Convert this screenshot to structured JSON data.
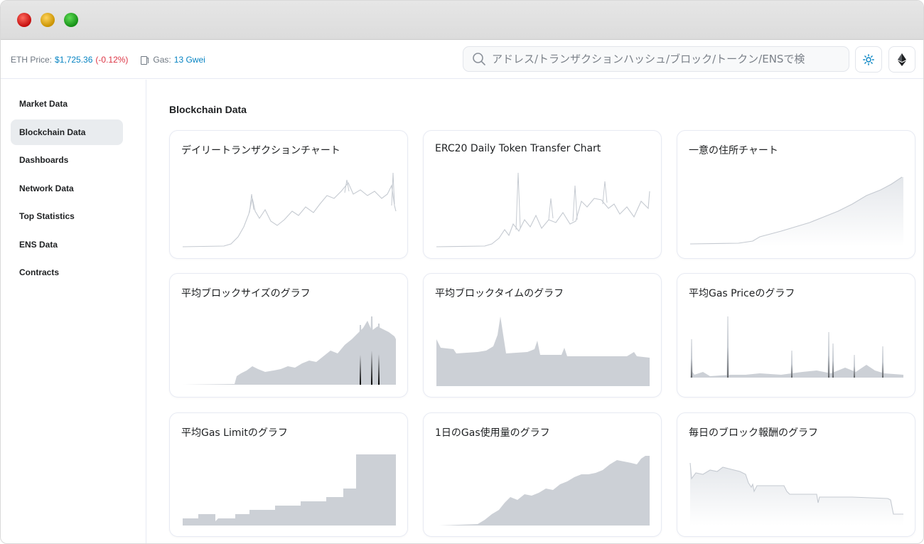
{
  "topbar": {
    "eth_price_label": "ETH Price:",
    "eth_price_value": "$1,725.36",
    "eth_price_change": "(-0.12%)",
    "gas_label": "Gas:",
    "gas_value": "13 Gwei"
  },
  "search": {
    "placeholder": "アドレス/トランザクションハッシュ/ブロック/トークン/ENSで検索"
  },
  "header_buttons": {
    "theme_icon": "sun-icon",
    "network_icon": "ethereum-icon"
  },
  "sidebar": {
    "items": [
      {
        "label": "Market Data",
        "active": false
      },
      {
        "label": "Blockchain Data",
        "active": true
      },
      {
        "label": "Dashboards",
        "active": false
      },
      {
        "label": "Network Data",
        "active": false
      },
      {
        "label": "Top Statistics",
        "active": false
      },
      {
        "label": "ENS Data",
        "active": false
      },
      {
        "label": "Contracts",
        "active": false
      }
    ]
  },
  "main": {
    "section_title": "Blockchain Data",
    "cards": [
      {
        "title": "デイリートランザクションチャート"
      },
      {
        "title": "ERC20 Daily Token Transfer Chart"
      },
      {
        "title": "一意の住所チャート"
      },
      {
        "title": "平均ブロックサイズのグラフ"
      },
      {
        "title": "平均ブロックタイムのグラフ"
      },
      {
        "title": "平均Gas Priceのグラフ"
      },
      {
        "title": "平均Gas Limitのグラフ"
      },
      {
        "title": "1日のGas使用量のグラフ"
      },
      {
        "title": "毎日のブロック報酬のグラフ"
      }
    ]
  },
  "colors": {
    "link": "#0784c3",
    "negative": "#dc3545",
    "chart_fill": "#ccd0d6",
    "chart_line": "#c5cad1"
  }
}
